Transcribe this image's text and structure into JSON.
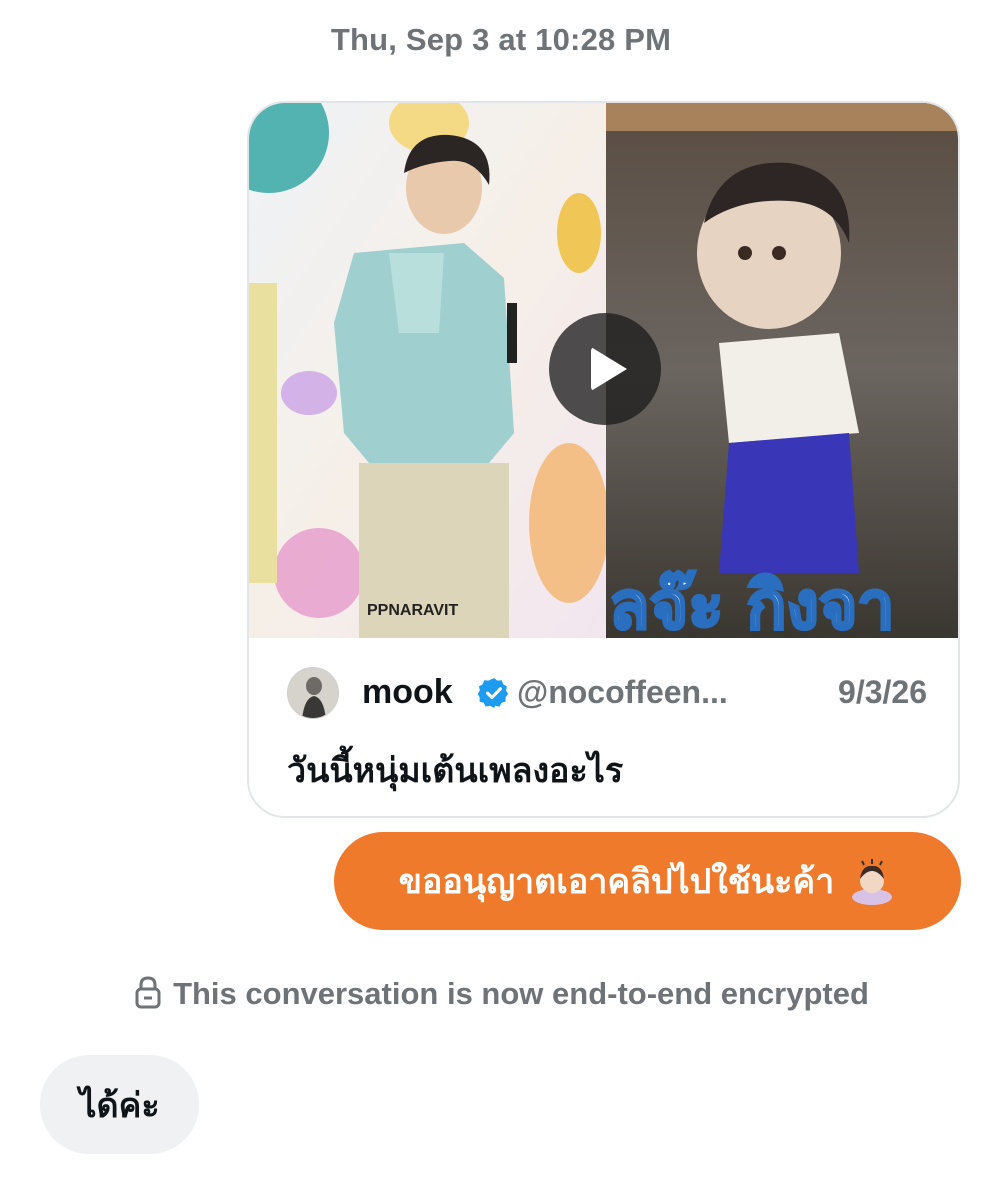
{
  "conversation": {
    "timestamp": "Thu, Sep 3 at 10:28 PM",
    "encryption_notice": "This conversation is now end-to-end encrypted"
  },
  "shared_post": {
    "author_name": "mook",
    "author_handle": "@nocoffeen...",
    "date": "9/3/26",
    "text": "วันนี้หนุ่มเต้นเพลงอะไร",
    "media": {
      "type": "video",
      "watermark": "PPNARAVIT",
      "overlay_caption": "ลจ๊ะ กิงจา"
    },
    "verified_icon": "verified-badge-icon"
  },
  "messages": [
    {
      "direction": "outgoing",
      "text": "ขออนุญาตเอาคลิปไปใช้นะค้า",
      "emoji": "person-bowing-emoji",
      "color": "#f07a2c"
    },
    {
      "direction": "incoming",
      "text": "ได้ค่ะ",
      "color": "#eff1f2"
    }
  ],
  "colors": {
    "accent": "#f07a2c",
    "muted_text": "#6e7378",
    "verified": "#1d9bf0"
  }
}
